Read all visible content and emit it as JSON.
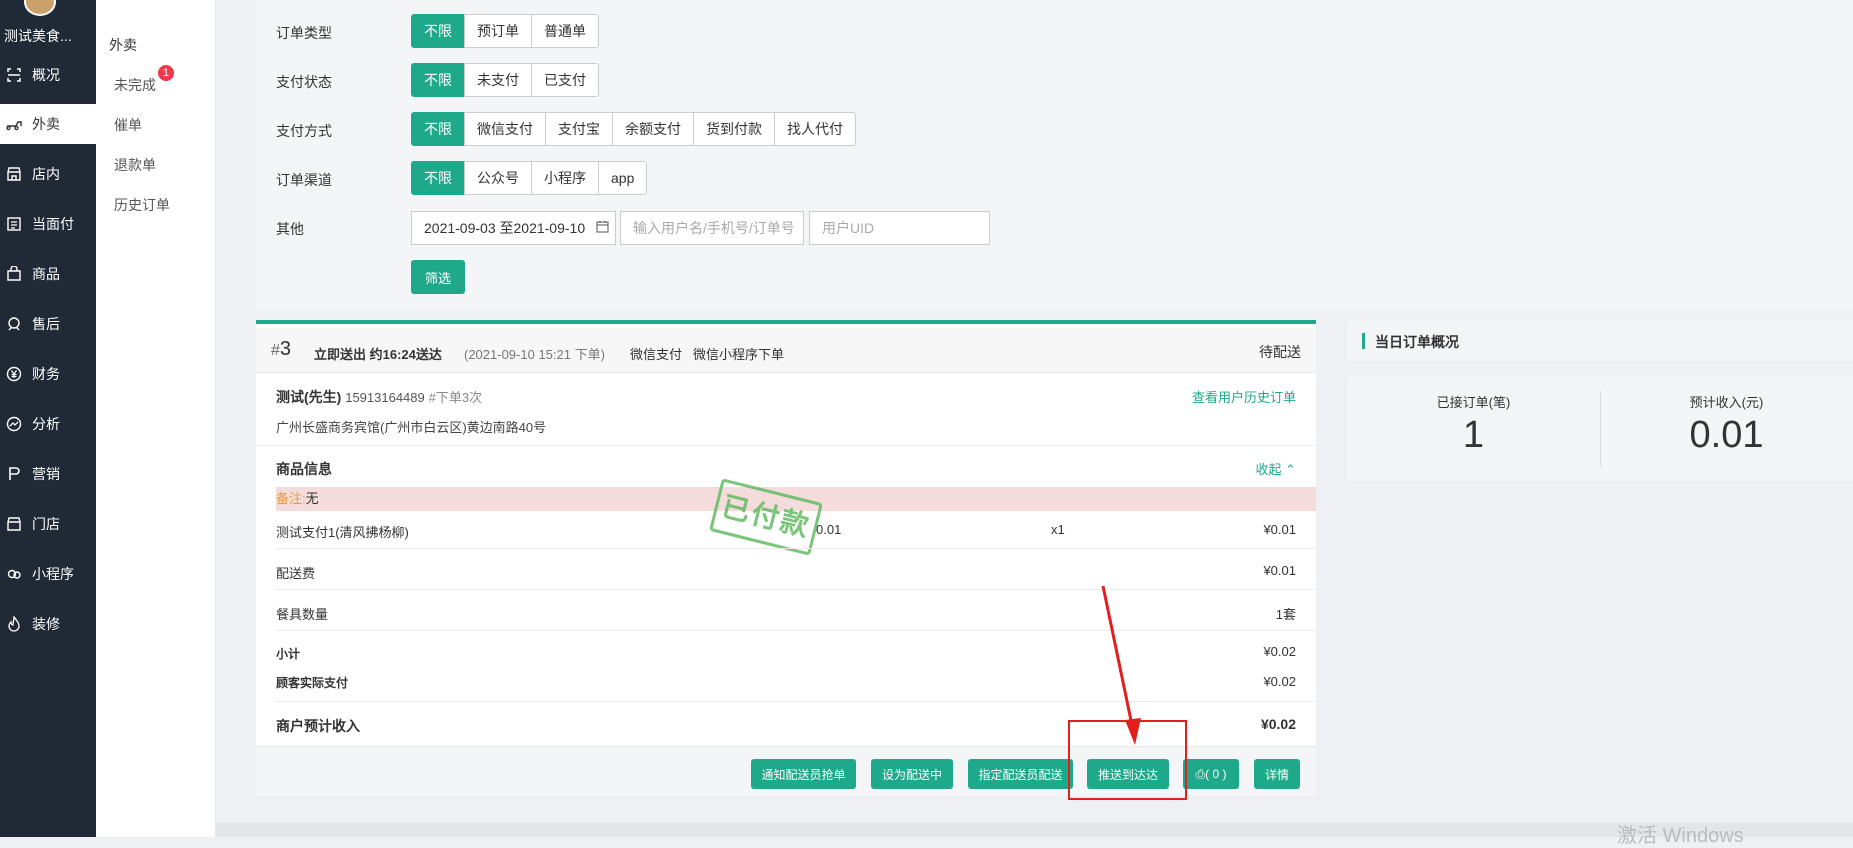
{
  "sidebar": {
    "shop_name": "测试美食...",
    "items": [
      {
        "label": "概况",
        "icon": "overview-icon"
      },
      {
        "label": "外卖",
        "icon": "delivery-icon"
      },
      {
        "label": "店内",
        "icon": "store-icon"
      },
      {
        "label": "当面付",
        "icon": "face-pay-icon"
      },
      {
        "label": "商品",
        "icon": "bag-icon"
      },
      {
        "label": "售后",
        "icon": "after-sale-icon"
      },
      {
        "label": "财务",
        "icon": "yen-icon"
      },
      {
        "label": "分析",
        "icon": "chart-icon"
      },
      {
        "label": "营销",
        "icon": "marketing-icon"
      },
      {
        "label": "门店",
        "icon": "shop-icon"
      },
      {
        "label": "小程序",
        "icon": "miniapp-icon"
      },
      {
        "label": "装修",
        "icon": "decorate-icon"
      }
    ],
    "active_index": 1
  },
  "subnav": {
    "heading": "外卖",
    "items": [
      {
        "label": "未完成",
        "badge": "1"
      },
      {
        "label": "催单"
      },
      {
        "label": "退款单"
      },
      {
        "label": "历史订单"
      }
    ]
  },
  "filters": {
    "order_type": {
      "label": "订单类型",
      "options": [
        "不限",
        "预订单",
        "普通单"
      ]
    },
    "pay_status": {
      "label": "支付状态",
      "options": [
        "不限",
        "未支付",
        "已支付"
      ]
    },
    "pay_method": {
      "label": "支付方式",
      "options": [
        "不限",
        "微信支付",
        "支付宝",
        "余额支付",
        "货到付款",
        "找人代付"
      ]
    },
    "channel": {
      "label": "订单渠道",
      "options": [
        "不限",
        "公众号",
        "小程序",
        "app"
      ]
    },
    "other": {
      "label": "其他",
      "date_range": "2021-09-03 至2021-09-10",
      "search_placeholder": "输入用户名/手机号/订单号",
      "uid_placeholder": "用户UID"
    },
    "submit_label": "筛选"
  },
  "order": {
    "number_prefix": "#",
    "number": "3",
    "delivery_text": "立即送出 约16:24送达",
    "time": "(2021-09-10 15:21 下单)",
    "pay_method": "微信支付",
    "source": "微信小程序下单",
    "status": "待配送",
    "customer_name": "测试(先生)",
    "phone": "15913164489",
    "order_count": "#下单3次",
    "history_link": "查看用户历史订单",
    "address": "广州长盛商务宾馆(广州市白云区)黄边南路40号",
    "goods_title": "商品信息",
    "collapse_label": "收起",
    "remark_label": "备注:",
    "remark_value": "无",
    "stamp": "已付款",
    "items": [
      {
        "name": "测试支付1(清风拂杨柳)",
        "price": "0.01",
        "qty": "x1",
        "total": "¥0.01"
      }
    ],
    "fees": [
      {
        "label": "配送费",
        "value": "¥0.01"
      },
      {
        "label": "餐具数量",
        "value": "1套"
      }
    ],
    "subtotal_label": "小计",
    "subtotal": "¥0.02",
    "actual_pay_label": "顾客实际支付",
    "actual_pay": "¥0.02",
    "income_label": "商户预计收入",
    "income": "¥0.02",
    "actions": {
      "notify": "通知配送员抢单",
      "set_delivering": "设为配送中",
      "assign": "指定配送员配送",
      "push_dada": "推送到达达",
      "print": "( 0 )",
      "detail": "详情"
    }
  },
  "stats": {
    "title": "当日订单概况",
    "orders_label": "已接订单(笔)",
    "orders_value": "1",
    "income_label": "预计收入(元)",
    "income_value": "0.01"
  },
  "watermark": "激活 Windows",
  "colors": {
    "accent": "#1fa98b",
    "sidebar": "#1f2a36",
    "badge": "#f1374a",
    "highlight_box": "#e21e1e"
  }
}
